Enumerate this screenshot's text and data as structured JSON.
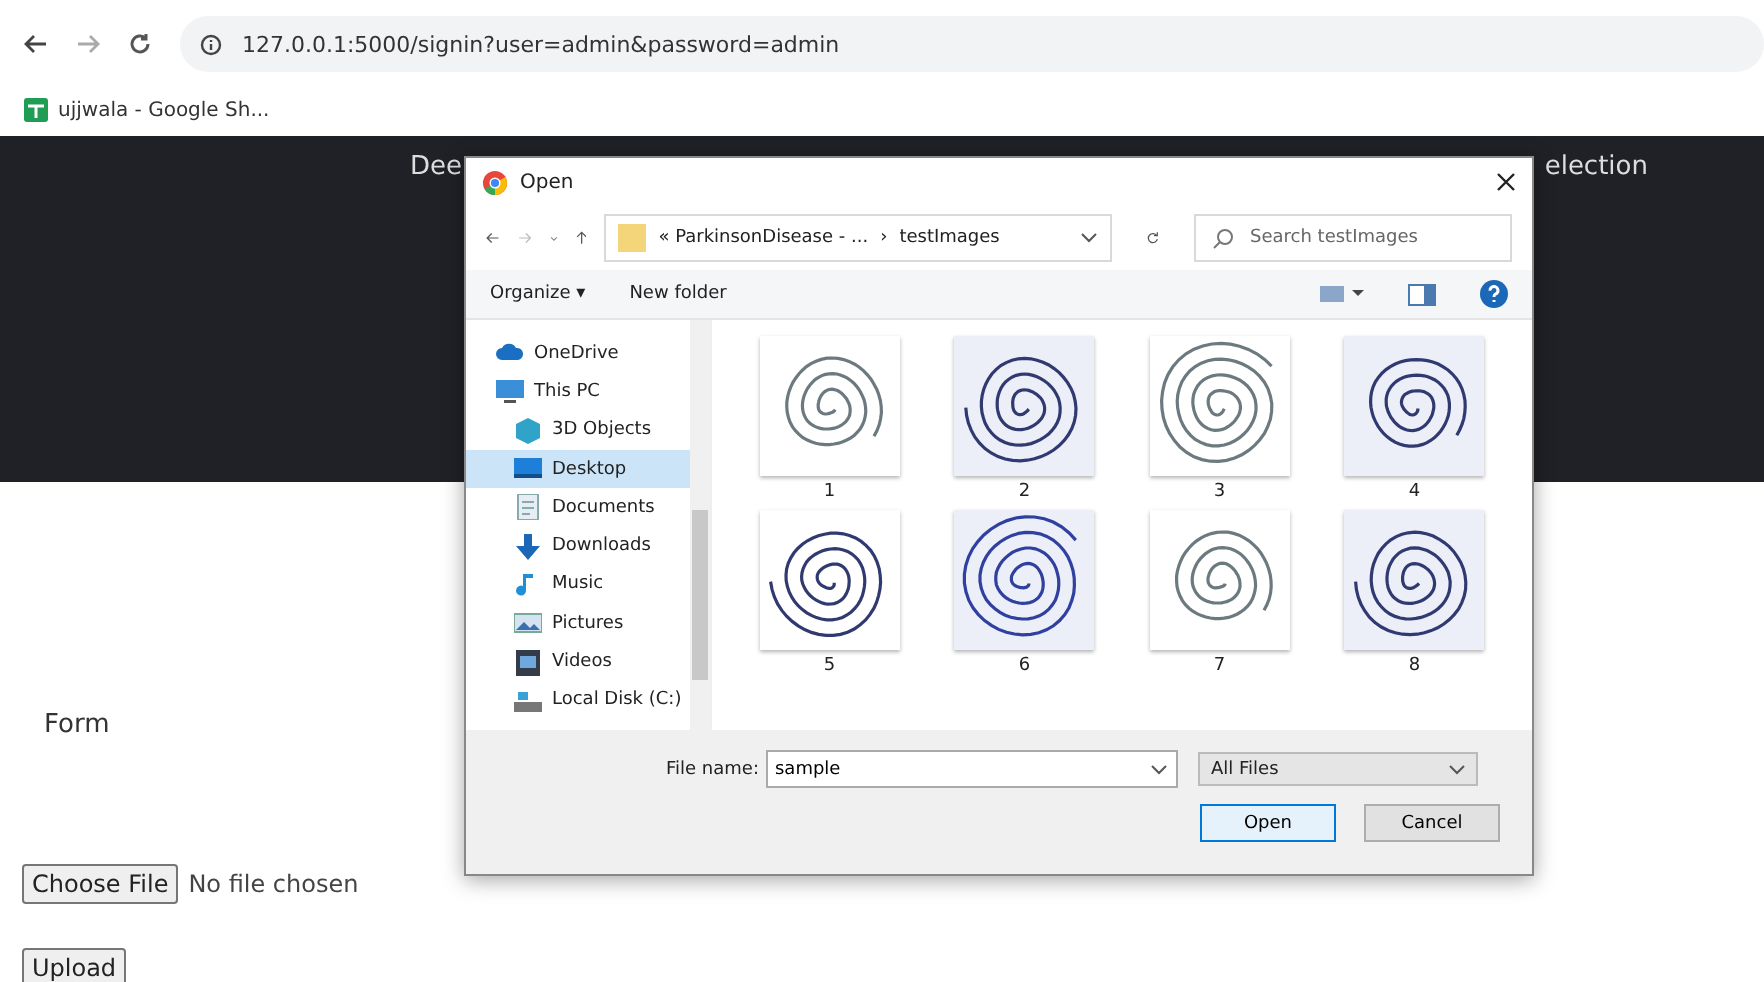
{
  "browser": {
    "url": "127.0.0.1:5000/signin?user=admin&password=admin",
    "bookmarks": [
      {
        "label": "ujjwala - Google Sh..."
      }
    ]
  },
  "banner": {
    "title_left": "Dee",
    "title_right": "election"
  },
  "form": {
    "heading": "Form",
    "choose_button": "Choose File",
    "file_status": "No file chosen",
    "upload_button": "Upload"
  },
  "dialog": {
    "title": "Open",
    "path": [
      "« ParkinsonDisease - ...",
      "›",
      "testImages"
    ],
    "search_placeholder": "Search testImages",
    "toolbar": {
      "organize": "Organize ▾",
      "new_folder": "New folder"
    },
    "nav": [
      {
        "label": "OneDrive",
        "kind": "cloud",
        "selected": false
      },
      {
        "label": "This PC",
        "kind": "pc",
        "selected": false,
        "children": [
          {
            "label": "3D Objects",
            "kind": "cube",
            "selected": false
          },
          {
            "label": "Desktop",
            "kind": "desktop",
            "selected": true
          },
          {
            "label": "Documents",
            "kind": "document",
            "selected": false
          },
          {
            "label": "Downloads",
            "kind": "download",
            "selected": false
          },
          {
            "label": "Music",
            "kind": "music",
            "selected": false
          },
          {
            "label": "Pictures",
            "kind": "pictures",
            "selected": false
          },
          {
            "label": "Videos",
            "kind": "video",
            "selected": false
          },
          {
            "label": "Local Disk (C:)",
            "kind": "disk",
            "selected": false
          }
        ]
      }
    ],
    "files": [
      {
        "name": "1"
      },
      {
        "name": "2"
      },
      {
        "name": "3"
      },
      {
        "name": "4"
      },
      {
        "name": "5"
      },
      {
        "name": "6"
      },
      {
        "name": "7"
      },
      {
        "name": "8"
      }
    ],
    "file_name_label": "File name:",
    "file_name": "sample",
    "file_type": "All Files",
    "open_button": "Open",
    "cancel_button": "Cancel"
  }
}
